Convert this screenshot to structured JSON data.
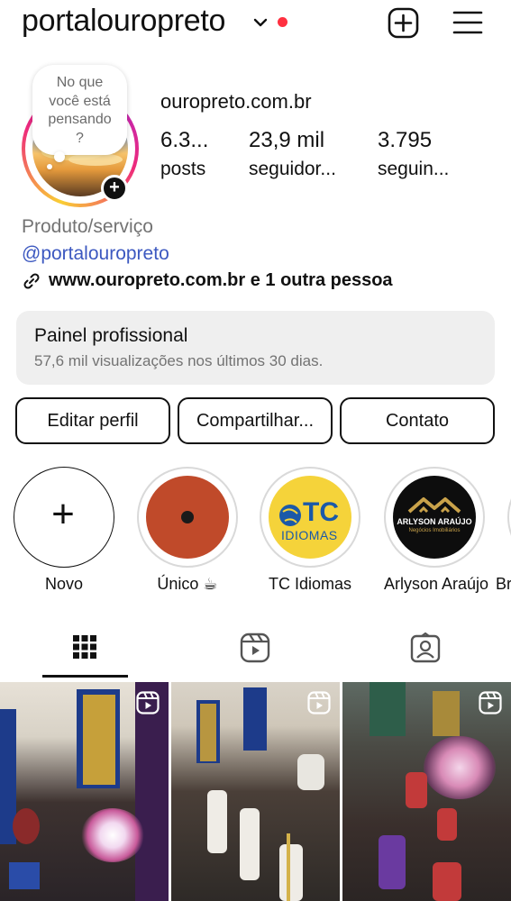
{
  "header": {
    "username": "portalouropreto"
  },
  "note": {
    "lines": [
      "No que",
      "você está",
      "pensando",
      "?"
    ]
  },
  "profile": {
    "website_top": "ouropreto.com.br",
    "stats": [
      {
        "num": "6.3...",
        "label": "posts"
      },
      {
        "num": "23,9 mil",
        "label": "seguidor..."
      },
      {
        "num": "3.795",
        "label": "seguin..."
      }
    ],
    "category": "Produto/serviço",
    "handle": "@portalouropreto",
    "links": "www.ouropreto.com.br e 1 outra pessoa"
  },
  "dashboard": {
    "title": "Painel profissional",
    "subtitle": "57,6 mil visualizações nos últimos 30 dias."
  },
  "buttons": {
    "edit": "Editar perfil",
    "share": "Compartilhar...",
    "contact": "Contato"
  },
  "highlights": [
    {
      "label": "Novo"
    },
    {
      "label": "Único ☕"
    },
    {
      "label": "TC Idiomas",
      "logo_text": "TC",
      "logo_sub": "IDIOMAS"
    },
    {
      "label": "Arlyson Araújo",
      "logo_text": "ARLYSON ARAÚJO",
      "logo_sub": "Negócios Imobiliários"
    },
    {
      "label": "Br"
    }
  ],
  "tabs": [
    "grid-icon",
    "reels-icon",
    "tagged-icon"
  ],
  "colors": {
    "accent_link": "#3c58c0",
    "notification_dot": "#ff3040",
    "highlight_unico": "#c04a2a",
    "tc_yellow": "#f5d33a",
    "tc_blue": "#1b59a8"
  }
}
